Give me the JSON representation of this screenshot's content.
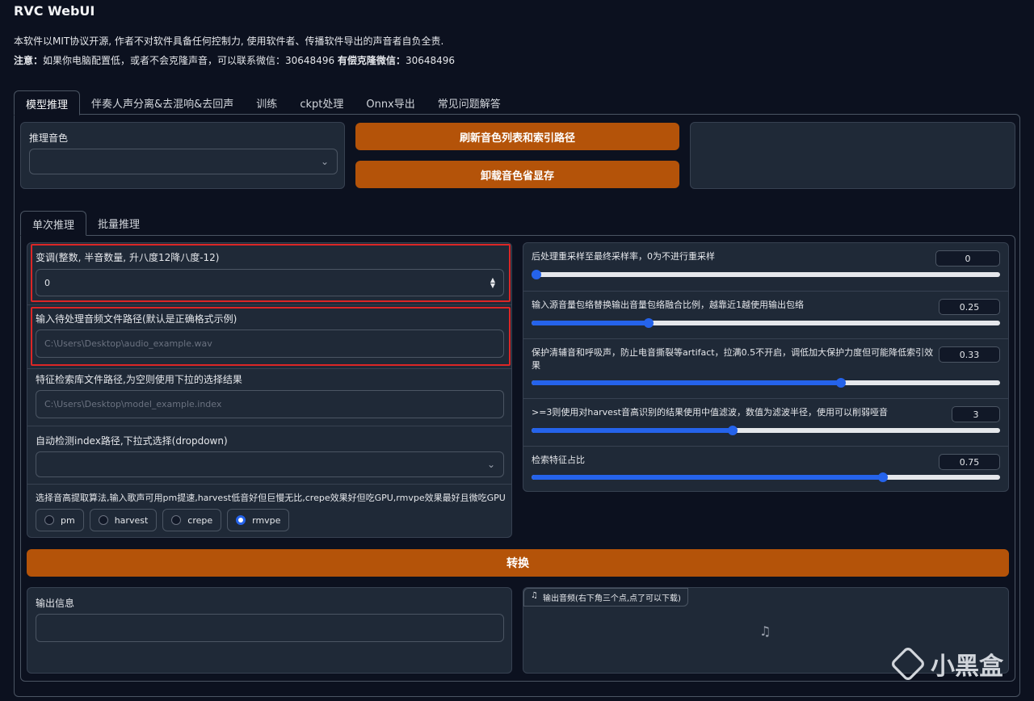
{
  "app": {
    "title": "RVC WebUI",
    "desc_line1": "本软件以MIT协议开源, 作者不对软件具备任何控制力, 使用软件者、传播软件导出的声音者自负全责.",
    "desc_line2_prefix": "注意：",
    "desc_line2_text": "如果你电脑配置低，或者不会克隆声音，可以联系微信：30648496 ",
    "desc_line2_bold": "有偿克隆微信：",
    "desc_line2_suffix": "30648496"
  },
  "tabs": [
    "模型推理",
    "伴奏人声分离&去混响&去回声",
    "训练",
    "ckpt处理",
    "Onnx导出",
    "常见问题解答"
  ],
  "top": {
    "voice_label": "推理音色",
    "refresh_button": "刷新音色列表和索引路径",
    "unload_button": "卸载音色省显存"
  },
  "subtabs": [
    "单次推理",
    "批量推理"
  ],
  "left": {
    "pitch_label": "变调(整数, 半音数量, 升八度12降八度-12)",
    "pitch_value": "0",
    "audio_path_label": "输入待处理音频文件路径(默认是正确格式示例)",
    "audio_path_placeholder": "C:\\Users\\Desktop\\audio_example.wav",
    "index_path_label": "特征检索库文件路径,为空则使用下拉的选择结果",
    "index_path_placeholder": "C:\\Users\\Desktop\\model_example.index",
    "auto_index_label": "自动检测index路径,下拉式选择(dropdown)",
    "f0_label": "选择音高提取算法,输入歌声可用pm提速,harvest低音好但巨慢无比,crepe效果好但吃GPU,rmvpe效果最好且微吃GPU",
    "f0_options": [
      "pm",
      "harvest",
      "crepe",
      "rmvpe"
    ],
    "f0_selected": "rmvpe"
  },
  "right": {
    "sliders": [
      {
        "label": "后处理重采样至最终采样率，0为不进行重采样",
        "value": "0",
        "fraction": 0.0
      },
      {
        "label": "输入源音量包络替换输出音量包络融合比例，越靠近1越使用输出包络",
        "value": "0.25",
        "fraction": 0.25
      },
      {
        "label": "保护清辅音和呼吸声，防止电音撕裂等artifact，拉满0.5不开启，调低加大保护力度但可能降低索引效果",
        "value": "0.33",
        "fraction": 0.66
      },
      {
        "label": ">=3则使用对harvest音高识别的结果使用中值滤波，数值为滤波半径，使用可以削弱哑音",
        "value": "3",
        "fraction": 0.43
      },
      {
        "label": "检索特征占比",
        "value": "0.75",
        "fraction": 0.75
      }
    ]
  },
  "convert_button": "转换",
  "output": {
    "info_label": "输出信息",
    "audio_label": "输出音频(右下角三个点,点了可以下载)"
  },
  "watermark": "小黑盒"
}
